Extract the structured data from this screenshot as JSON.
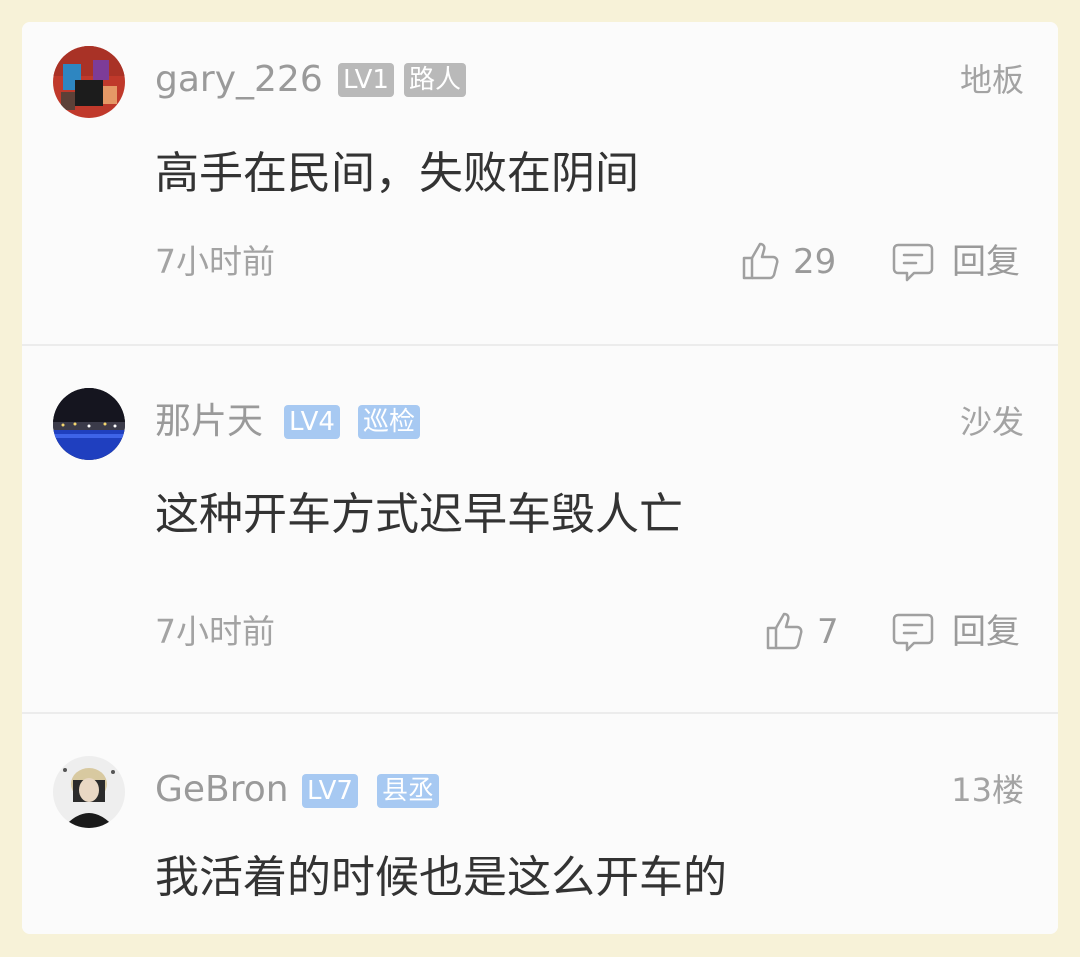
{
  "comments": [
    {
      "username": "gary_226",
      "level": "LV1",
      "title": "路人",
      "floor": "地板",
      "content": "高手在民间，失败在阴间",
      "time": "7小时前",
      "likes": "29",
      "reply_label": "回复",
      "badge_color": "#b9b9b9"
    },
    {
      "username": "那片天",
      "level": "LV4",
      "title": "巡检",
      "floor": "沙发",
      "content": "这种开车方式迟早车毁人亡",
      "time": "7小时前",
      "likes": "7",
      "reply_label": "回复",
      "badge_color": "#a7c9f2"
    },
    {
      "username": "GeBron",
      "level": "LV7",
      "title": "县丞",
      "floor": "13楼",
      "content": "我活着的时候也是这么开车的",
      "badge_color": "#a7c9f2"
    }
  ],
  "icons": {
    "like": "thumbs-up-icon",
    "reply": "comment-bubble-icon"
  },
  "colors": {
    "page_background": "#f7f2d8",
    "card_background": "#fbfbfb",
    "text_primary": "#333333",
    "text_secondary": "#9a9a9a"
  }
}
